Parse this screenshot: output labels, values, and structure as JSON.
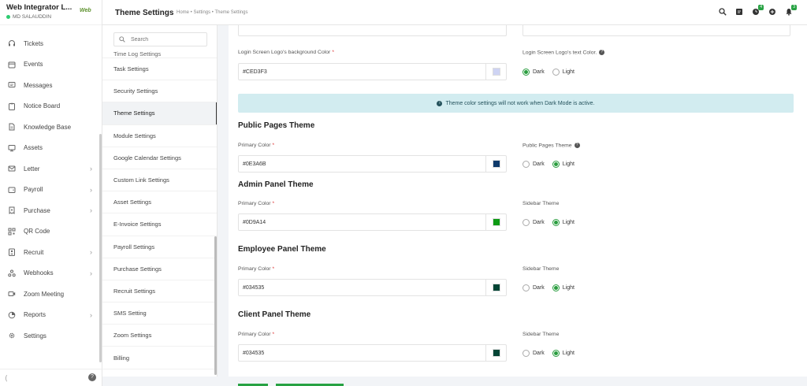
{
  "brand": {
    "name": "Web Integrator L...",
    "user": "MD SALAUDDIN",
    "logo_text": "Web"
  },
  "nav": [
    {
      "label": "Tickets",
      "icon": "headset-icon",
      "chevron": false
    },
    {
      "label": "Events",
      "icon": "calendar-icon",
      "chevron": false
    },
    {
      "label": "Messages",
      "icon": "message-icon",
      "chevron": false
    },
    {
      "label": "Notice Board",
      "icon": "clipboard-icon",
      "chevron": false
    },
    {
      "label": "Knowledge Base",
      "icon": "document-icon",
      "chevron": false
    },
    {
      "label": "Assets",
      "icon": "monitor-icon",
      "chevron": false
    },
    {
      "label": "Letter",
      "icon": "envelope-icon",
      "chevron": true
    },
    {
      "label": "Payroll",
      "icon": "wallet-icon",
      "chevron": true
    },
    {
      "label": "Purchase",
      "icon": "receipt-icon",
      "chevron": true
    },
    {
      "label": "QR Code",
      "icon": "qrcode-icon",
      "chevron": false
    },
    {
      "label": "Recruit",
      "icon": "briefcase-icon",
      "chevron": true
    },
    {
      "label": "Webhooks",
      "icon": "webhook-icon",
      "chevron": true
    },
    {
      "label": "Zoom Meeting",
      "icon": "video-icon",
      "chevron": false
    },
    {
      "label": "Reports",
      "icon": "pie-chart-icon",
      "chevron": true
    },
    {
      "label": "Settings",
      "icon": "gear-icon",
      "chevron": false
    }
  ],
  "header": {
    "title": "Theme Settings",
    "breadcrumb": "Home • Settings • Theme Settings"
  },
  "top_badges": {
    "clock": "4",
    "bell": "3"
  },
  "submenu": {
    "search_placeholder": "Search",
    "partial_item": "Time Log Settings",
    "items": [
      "Task Settings",
      "Security Settings",
      "Theme Settings",
      "Module Settings",
      "Google Calendar Settings",
      "Custom Link Settings",
      "Asset Settings",
      "E-Invoice Settings",
      "Payroll Settings",
      "Purchase Settings",
      "Recruit Settings",
      "SMS Setting",
      "Zoom Settings",
      "Billing"
    ],
    "active": "Theme Settings"
  },
  "login": {
    "bg_label": "Login Screen Logo's background Color",
    "bg_value": "#CED3F3",
    "bg_color": "#CED3F3",
    "text_label": "Login Screen Logo's text Color.",
    "dark": "Dark",
    "light": "Light",
    "selected": "Dark"
  },
  "alert": "Theme color settings will not work when Dark Mode is active.",
  "public": {
    "heading": "Public Pages Theme",
    "primary_label": "Primary Color",
    "primary_value": "#0E3A6B",
    "color": "#0E3A6B",
    "theme_label": "Public Pages Theme",
    "dark": "Dark",
    "light": "Light",
    "selected": "Light"
  },
  "admin": {
    "heading": "Admin Panel Theme",
    "primary_label": "Primary Color",
    "primary_value": "#0D9A14",
    "color": "#0D9A14",
    "theme_label": "Sidebar Theme",
    "dark": "Dark",
    "light": "Light",
    "selected": "Light"
  },
  "employee": {
    "heading": "Employee Panel Theme",
    "primary_label": "Primary Color",
    "primary_value": "#034535",
    "color": "#034535",
    "theme_label": "Sidebar Theme",
    "dark": "Dark",
    "light": "Light",
    "selected": "Light"
  },
  "client": {
    "heading": "Client Panel Theme",
    "primary_label": "Primary Color",
    "primary_value": "#034535",
    "color": "#034535",
    "theme_label": "Sidebar Theme",
    "dark": "Dark",
    "light": "Light",
    "selected": "Light"
  },
  "colors": {
    "accent": "#27A243",
    "alert_bg": "#D2ECF0"
  }
}
